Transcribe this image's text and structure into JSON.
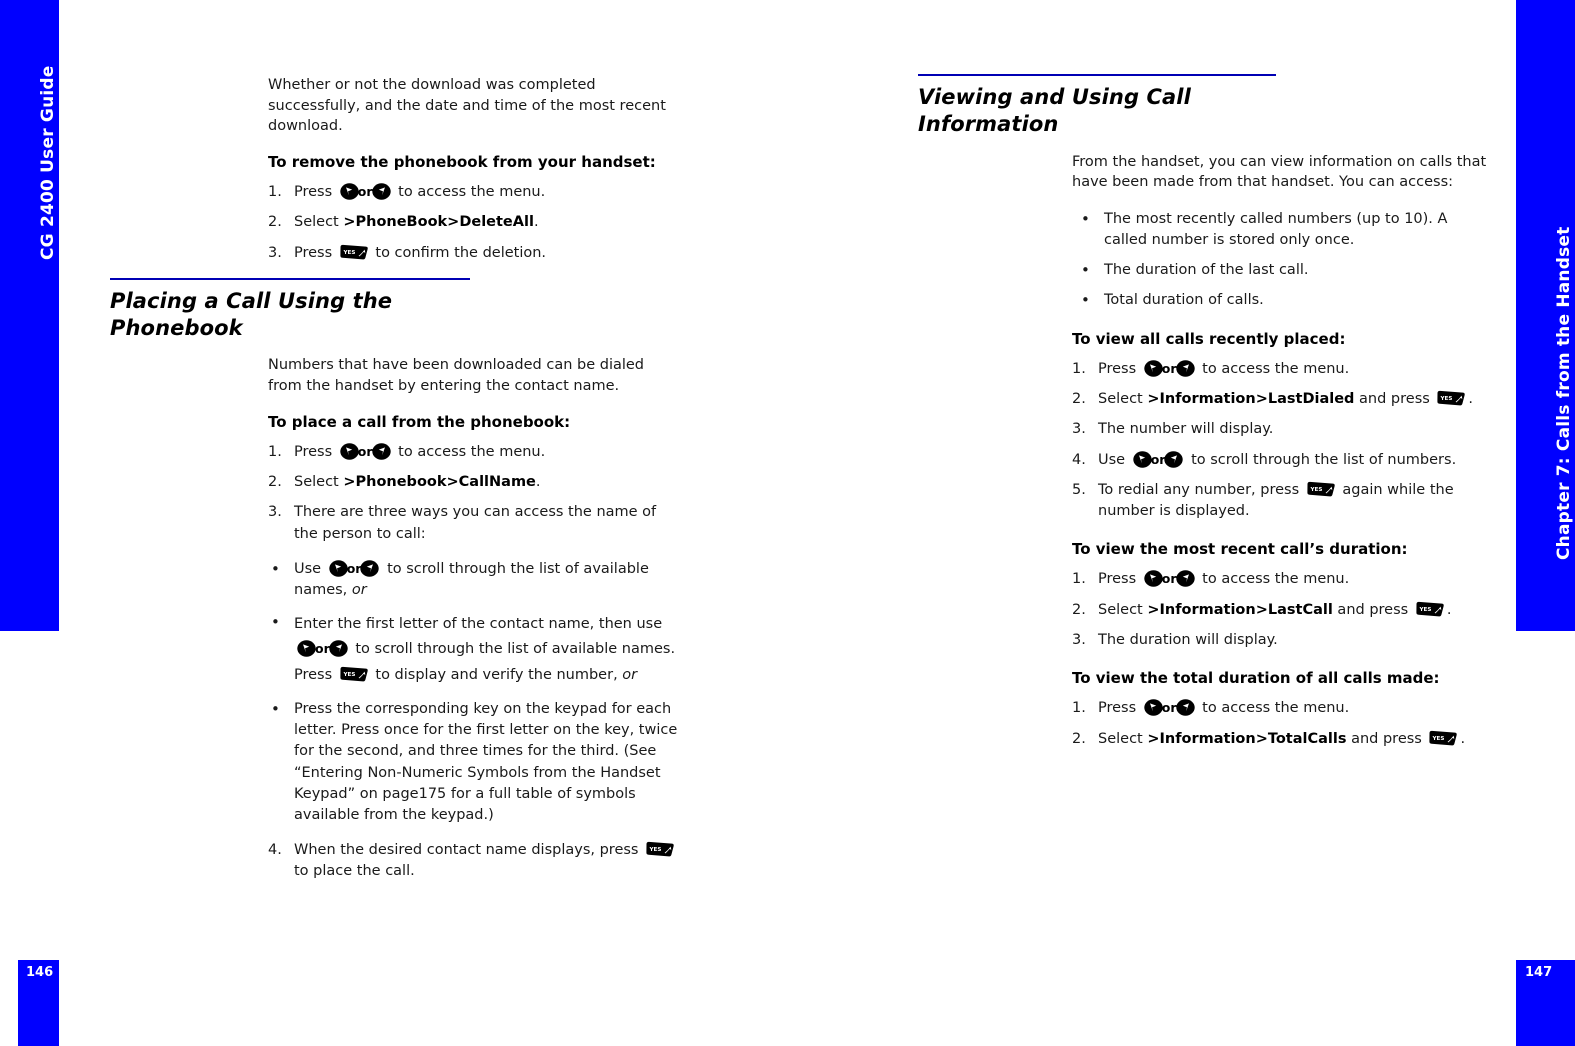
{
  "document": {
    "left_tab_label": "CG 2400 User Guide",
    "right_tab_label": "Chapter 7: Calls from the Handset",
    "page_left": "146",
    "page_right": "147"
  },
  "icons": {
    "nav_key": "nav-key-icon",
    "yes_key": "yes-key-icon",
    "or_word": "or"
  },
  "left_column": {
    "intro_paragraph": "Whether or not the download was completed successfully, and the date and time of the most recent download.",
    "procedure_remove": {
      "title": "To remove the phonebook from your handset:",
      "steps": [
        {
          "num": "1.",
          "pre": "Press ",
          "keys": "nav",
          "post": " to access the menu."
        },
        {
          "num": "2.",
          "pre": "Select ",
          "cmd": ">PhoneBook>DeleteAll",
          "post": "."
        },
        {
          "num": "3.",
          "pre": "Press ",
          "keys": "yes",
          "post": " to confirm the deletion."
        }
      ]
    },
    "section": {
      "title": "Placing a Call Using the Phonebook",
      "intro_paragraph": "Numbers that have been downloaded can be dialed from the handset by entering the contact name.",
      "procedure_place": {
        "title": "To place a call from the phonebook:",
        "steps": [
          {
            "num": "1.",
            "pre": "Press ",
            "keys": "nav",
            "post": " to access the menu."
          },
          {
            "num": "2.",
            "pre": "Select ",
            "cmd": ">Phonebook>CallName",
            "post": "."
          },
          {
            "num": "3.",
            "pre": "There are three ways you can access the name of the person to call:",
            "keys": "none",
            "post": ""
          }
        ],
        "bullets": [
          {
            "pre": "Use ",
            "keys": "nav",
            "post": " to scroll through the list of available names, ",
            "em": "or"
          },
          {
            "pre": "Enter the first letter of the contact name, then use ",
            "keys": "nav",
            "mid": " to scroll through the list of available names. Press ",
            "keys2": "yes",
            "post": " to display and verify the number, ",
            "em": "or"
          },
          {
            "pre": "Press the corresponding key on the keypad for each letter. Press once for the first letter on the key, twice for the second, and three times for the third. (See “Entering Non-Numeric Symbols from the Handset Keypad” on page175 for a full table of symbols available from the keypad.)",
            "keys": "none",
            "post": ""
          }
        ],
        "final_step": {
          "num": "4.",
          "pre": "When the desired contact name displays, press ",
          "keys": "yes",
          "post": " to place the call."
        }
      }
    }
  },
  "right_column": {
    "section": {
      "title": "Viewing and Using Call Information",
      "intro_paragraph": "From the handset, you can view information on calls that have been made from that handset. You can access:",
      "bullets": [
        "The most recently called numbers (up to 10). A called number is stored only once.",
        "The duration of the last call.",
        "Total duration of calls."
      ]
    },
    "procedure_recent": {
      "title": "To view all calls recently placed:",
      "steps": [
        {
          "num": "1.",
          "pre": "Press ",
          "keys": "nav",
          "post": " to access the menu."
        },
        {
          "num": "2.",
          "pre": "Select ",
          "cmd": ">Information>LastDialed",
          "mid": " and press ",
          "keys": "yes",
          "post": "."
        },
        {
          "num": "3.",
          "pre": "The number will display.",
          "keys": "none",
          "post": ""
        },
        {
          "num": "4.",
          "pre": "Use ",
          "keys": "nav",
          "post": " to scroll through the list of numbers."
        },
        {
          "num": "5.",
          "pre": "To redial any number, press ",
          "keys": "yes",
          "post": " again while the number is displayed."
        }
      ]
    },
    "procedure_last_duration": {
      "title": "To view the most recent call’s duration:",
      "steps": [
        {
          "num": "1.",
          "pre": "Press ",
          "keys": "nav",
          "post": " to access the menu."
        },
        {
          "num": "2.",
          "pre": "Select ",
          "cmd": ">Information>LastCall",
          "mid": " and press ",
          "keys": "yes",
          "post": "."
        },
        {
          "num": "3.",
          "pre": "The duration will display.",
          "keys": "none",
          "post": ""
        }
      ]
    },
    "procedure_total_duration": {
      "title": "To view the total duration of all calls made:",
      "steps": [
        {
          "num": "1.",
          "pre": "Press ",
          "keys": "nav",
          "post": " to access the menu."
        },
        {
          "num": "2.",
          "pre": "Select ",
          "cmd": ">Information>TotalCalls",
          "mid": " and press ",
          "keys": "yes",
          "post": "."
        }
      ]
    }
  },
  "colors": {
    "tab_blue": "#0000ff",
    "rule_blue": "#0000b4",
    "text": "#1a1a1a"
  }
}
